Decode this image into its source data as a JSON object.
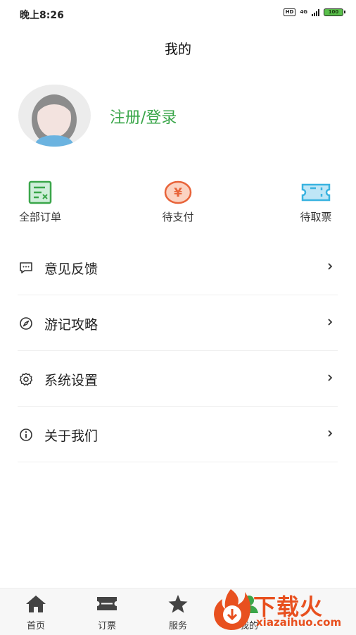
{
  "status_bar": {
    "time": "晚上8:26",
    "hd": "HD",
    "network": "4G",
    "battery": "100"
  },
  "header": {
    "title": "我的"
  },
  "profile": {
    "login_label": "注册/登录"
  },
  "orders": [
    {
      "label": "全部订单",
      "icon": "receipt-icon",
      "color": "#3aa64a"
    },
    {
      "label": "待支付",
      "icon": "yen-coin-icon",
      "color": "#e8643a"
    },
    {
      "label": "待取票",
      "icon": "ticket-icon",
      "color": "#3ab3e0"
    }
  ],
  "menu": [
    {
      "label": "意见反馈",
      "icon": "message-icon"
    },
    {
      "label": "游记攻略",
      "icon": "compass-icon"
    },
    {
      "label": "系统设置",
      "icon": "gear-icon"
    },
    {
      "label": "关于我们",
      "icon": "info-icon"
    }
  ],
  "tabbar": [
    {
      "label": "首页",
      "icon": "home-icon"
    },
    {
      "label": "订票",
      "icon": "ticket-icon"
    },
    {
      "label": "服务",
      "icon": "star-icon"
    },
    {
      "label": "我的",
      "icon": "user-icon"
    }
  ],
  "watermark": {
    "text": "下载火",
    "url": "xiazaihuo.com"
  }
}
